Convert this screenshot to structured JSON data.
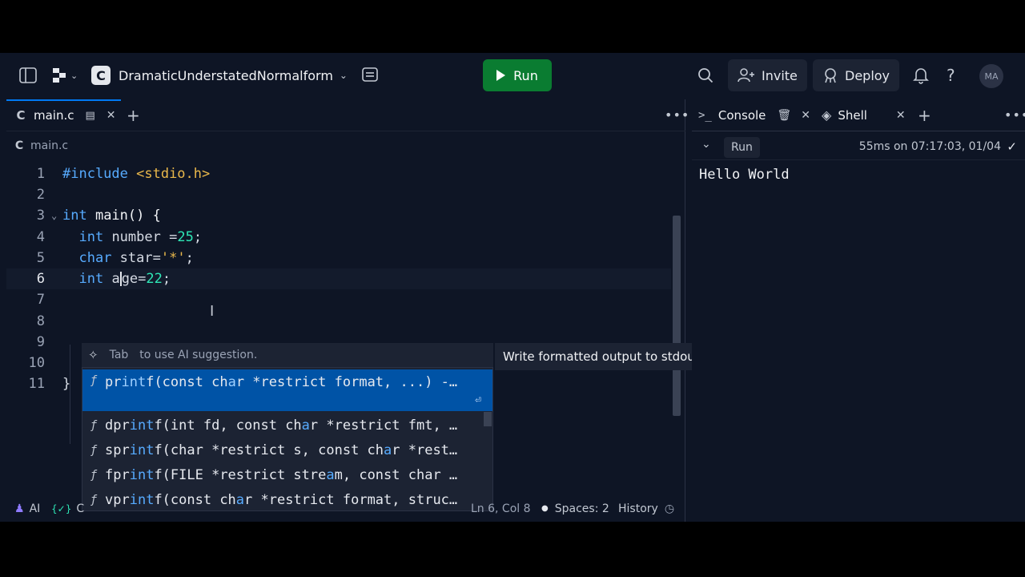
{
  "topbar": {
    "repl_name": "DramaticUnderstatedNormalform",
    "run_label": "Run",
    "invite_label": "Invite",
    "deploy_label": "Deploy",
    "avatar_initials": "MA"
  },
  "editor": {
    "tab_label": "main.c",
    "breadcrumb": "main.c",
    "line_numbers": [
      "1",
      "2",
      "3",
      "4",
      "5",
      "6",
      "7",
      "8",
      "9",
      "10",
      "11"
    ],
    "code": {
      "l1_directive": "#include",
      "l1_header": " <stdio.h>",
      "l3_type": "int",
      "l3_rest": " main() {",
      "l4_type": "int",
      "l4_name": " number =",
      "l4_value": "25",
      "l4_end": ";",
      "l5_type": "char",
      "l5_name": " star=",
      "l5_value": "'*'",
      "l5_end": ";",
      "l6_type": "int",
      "l6_name_a": " a",
      "l6_name_b": "ge=",
      "l6_value": "22",
      "l6_end": ";",
      "l11": "}"
    }
  },
  "autocomplete": {
    "ai_key": "Tab",
    "ai_text": "to use AI suggestion.",
    "doc": "Write formatted output to stdout.",
    "items": [
      {
        "a": "pr",
        "m1": "int",
        "b": "f(const ch",
        "m2": "a",
        "c": "r *restrict format, ...) -…"
      },
      {
        "a": "dpr",
        "m1": "int",
        "b": "f(int fd, const ch",
        "m2": "a",
        "c": "r *restrict fmt, …"
      },
      {
        "a": "spr",
        "m1": "int",
        "b": "f(char *restrict s, const ch",
        "m2": "a",
        "c": "r *rest…"
      },
      {
        "a": "fpr",
        "m1": "int",
        "b": "f(FILE *restrict stre",
        "m2": "a",
        "c": "m, const char …"
      },
      {
        "a": "vpr",
        "m1": "int",
        "b": "f(const ch",
        "m2": "a",
        "c": "r *restrict format, struc…"
      }
    ]
  },
  "statusbar": {
    "ai_label": "AI",
    "lang_label": "C",
    "position": "Ln 6, Col 8",
    "spaces": "Spaces: 2",
    "history": "History"
  },
  "console": {
    "tab_console": "Console",
    "tab_shell": "Shell",
    "run_chip": "Run",
    "timing": "55ms on 07:17:03, 01/04",
    "output": "Hello World"
  },
  "colors": {
    "run_green": "#0a7c31",
    "selection_blue": "#0053a6",
    "keyword_blue": "#57abff",
    "number_teal": "#2ee7b6",
    "string_yellow": "#e9b84b"
  }
}
